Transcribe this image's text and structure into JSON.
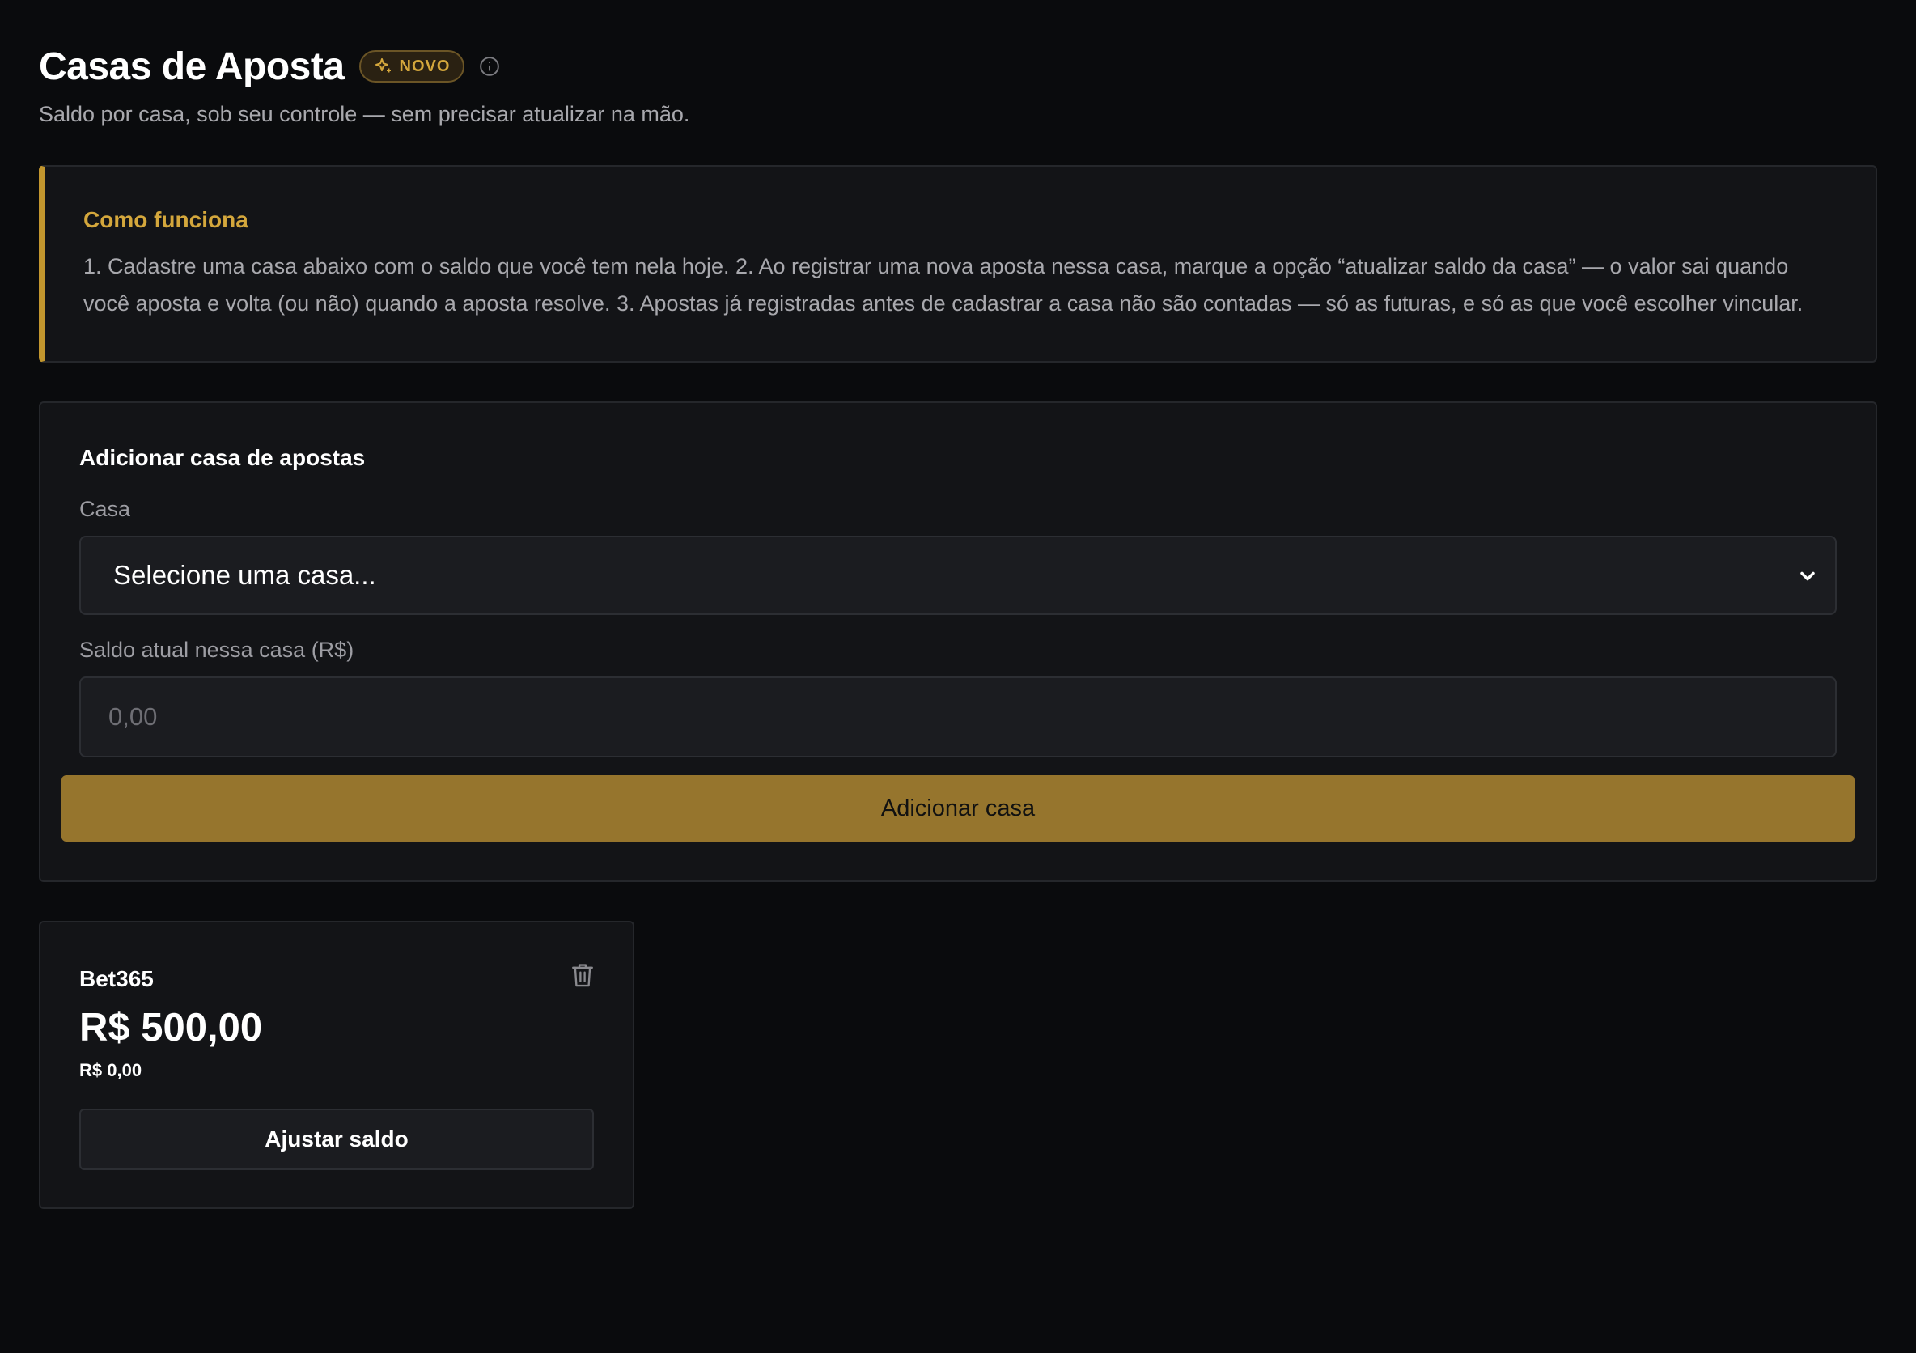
{
  "header": {
    "title": "Casas de Aposta",
    "badge": "NOVO",
    "subtitle": "Saldo por casa, sob seu controle — sem precisar atualizar na mão."
  },
  "how_it_works": {
    "title": "Como funciona",
    "text": "1. Cadastre uma casa abaixo com o saldo que você tem nela hoje. 2. Ao registrar uma nova aposta nessa casa, marque a opção “atualizar saldo da casa” — o valor sai quando você aposta e volta (ou não) quando a aposta resolve. 3. Apostas já registradas antes de cadastrar a casa não são contadas — só as futuras, e só as que você escolher vincular."
  },
  "add_form": {
    "heading": "Adicionar casa de apostas",
    "casa_label": "Casa",
    "casa_select_value": "Selecione uma casa...",
    "saldo_label": "Saldo atual nessa casa (R$)",
    "saldo_placeholder": "0,00",
    "submit_label": "Adicionar casa"
  },
  "casas": [
    {
      "name": "Bet365",
      "balance": "R$ 500,00",
      "sub_value": "R$ 0,00",
      "adjust_label": "Ajustar saldo"
    }
  ],
  "colors": {
    "background": "#0a0b0d",
    "card": "#131417",
    "accent": "#c2962e",
    "button": "#96752d",
    "muted_text": "#a8a8ad"
  },
  "icons": {
    "badge": "sparkle-icon",
    "info": "info-icon",
    "select": "chevron-down-icon",
    "delete": "trash-icon"
  }
}
